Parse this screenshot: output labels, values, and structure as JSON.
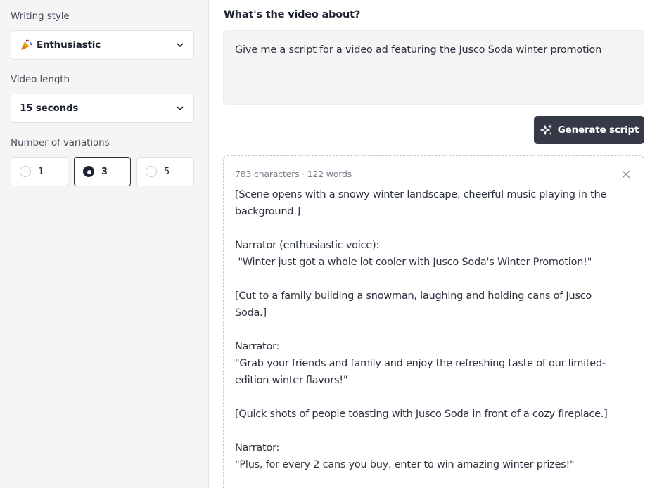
{
  "sidebar": {
    "writing_style_label": "Writing style",
    "writing_style_value": "Enthusiastic",
    "video_length_label": "Video length",
    "video_length_value": "15 seconds",
    "variations_label": "Number of variations",
    "variations": [
      {
        "label": "1",
        "selected": false
      },
      {
        "label": "3",
        "selected": true
      },
      {
        "label": "5",
        "selected": false
      }
    ]
  },
  "main": {
    "title": "What's the video about?",
    "prompt": "Give me a script for a video ad featuring the Jusco Soda winter promotion",
    "generate_label": "Generate script",
    "result": {
      "meta": "783 characters · 122 words",
      "lines": [
        "[Scene opens with a snowy winter landscape, cheerful music playing in the",
        "background.]",
        "",
        "Narrator (enthusiastic voice):",
        " \"Winter just got a whole lot cooler with Jusco Soda's Winter Promotion!\"",
        "",
        "[Cut to a family building a snowman, laughing and holding cans of Jusco",
        "Soda.]",
        "",
        "Narrator:",
        "\"Grab your friends and family and enjoy the refreshing taste of our limited-",
        "edition winter flavors!\"",
        "",
        "[Quick shots of people toasting with Jusco Soda in front of a cozy fireplace.]",
        "",
        "Narrator:",
        "\"Plus, for every 2 cans you buy, enter to win amazing winter prizes!\""
      ]
    }
  },
  "icons": {
    "style_emoji": "party-popper-icon",
    "chevron": "chevron-down-icon",
    "sparkle": "sparkle-icon",
    "close": "close-icon"
  },
  "colors": {
    "button_bg": "#363a46",
    "sidebar_bg": "#f5f5f6",
    "text": "#1f2433"
  }
}
